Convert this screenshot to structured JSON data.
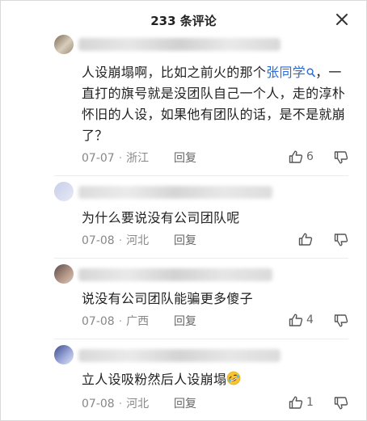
{
  "header": {
    "title": "233 条评论"
  },
  "comments": [
    {
      "text_before": "人设崩塌啊，比如之前火的那个",
      "link": "张同学",
      "text_after": "，一直打的旗号就是没团队自己一个人，走的淳朴怀旧的人设，如果他有团队的话，是不是就崩了？",
      "date": "07-07",
      "sep": "·",
      "location": "浙江",
      "reply": "回复",
      "likes": "6"
    },
    {
      "text": "为什么要说没有公司团队呢",
      "date": "07-08",
      "sep": "·",
      "location": "河北",
      "reply": "回复",
      "likes": ""
    },
    {
      "text": "说没有公司团队能骗更多傻子",
      "date": "07-08",
      "sep": "·",
      "location": "广西",
      "reply": "回复",
      "likes": "4"
    },
    {
      "text": "立人设吸粉然后人设崩塌",
      "emoji": "rolling-laughing-emoji",
      "date": "07-08",
      "sep": "·",
      "location": "河北",
      "reply": "回复",
      "likes": "1"
    }
  ],
  "icons": {
    "close": "close-icon",
    "like": "thumbs-up-icon",
    "dislike": "thumbs-down-icon",
    "search": "search-icon"
  },
  "colors": {
    "link": "#2b6bd6",
    "meta": "#888888",
    "text": "#222222"
  }
}
